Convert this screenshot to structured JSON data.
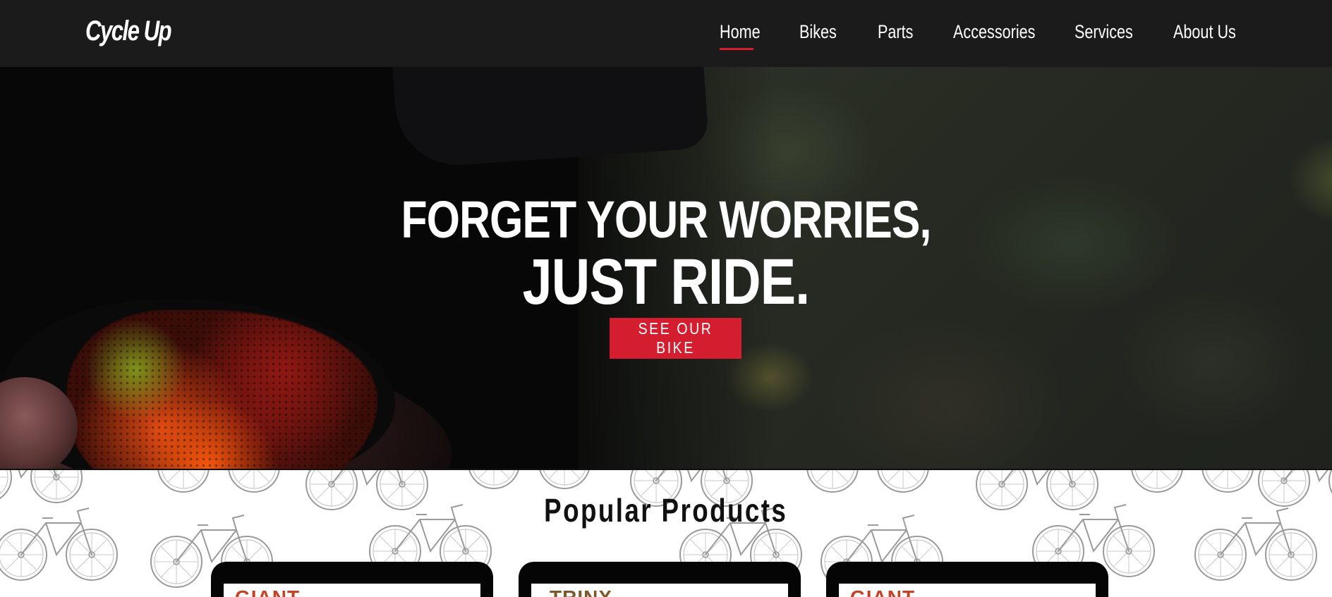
{
  "header": {
    "brand": "Cycle Up",
    "nav": [
      {
        "label": "Home",
        "active": true
      },
      {
        "label": "Bikes",
        "active": false
      },
      {
        "label": "Parts",
        "active": false
      },
      {
        "label": "Accessories",
        "active": false
      },
      {
        "label": "Services",
        "active": false
      },
      {
        "label": "About Us",
        "active": false
      }
    ]
  },
  "hero": {
    "title_line1": "FORGET YOUR WORRIES,",
    "title_line2": "JUST RIDE.",
    "cta_label": "SEE OUR BIKE"
  },
  "products": {
    "title": "Popular Products",
    "cards": [
      {
        "brand": "GIANT",
        "brand_color": "#c0442a"
      },
      {
        "brand": "TRINX",
        "brand_color": "#7a5a2a"
      },
      {
        "brand": "GIANT",
        "brand_color": "#c0442a"
      }
    ]
  },
  "colors": {
    "nav_bg": "#1b1b1b",
    "accent": "#d51d30"
  }
}
